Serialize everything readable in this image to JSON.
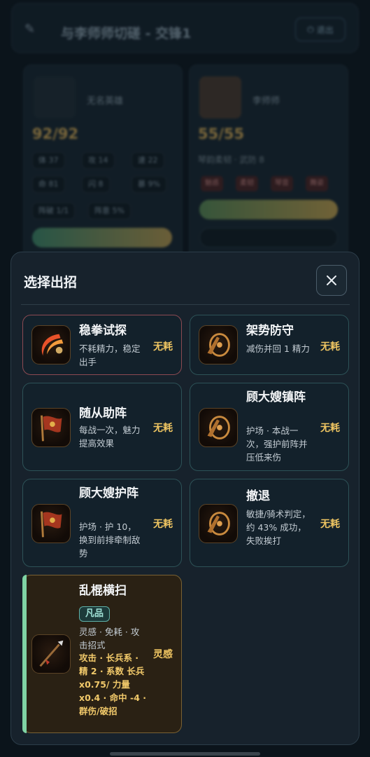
{
  "background": {
    "title": "与李师师切磋 - 交锋1",
    "title_button": "退出",
    "left_card": {
      "name": "无名英雄",
      "hp": "92/92",
      "stats": [
        "体 37",
        "攻 14",
        "速 22",
        "命 81",
        "闪 8",
        "暴 9%"
      ],
      "extra": [
        "阵破 1/1",
        "阵意 5%"
      ]
    },
    "right_card": {
      "name": "李师师",
      "hp": "55/55",
      "sub": "琴韵柔韧 · 武防 8",
      "tags": [
        "魅惑",
        "柔韧",
        "琴音",
        "舞姿"
      ]
    }
  },
  "modal": {
    "title": "选择出招",
    "close_icon": "close-icon",
    "skills": [
      {
        "name": "稳拳试探",
        "desc": "不耗精力，稳定出手",
        "cost": "无耗",
        "icon": "slash-icon",
        "selected": true
      },
      {
        "name": "架势防守",
        "desc": "减伤并回 1 精力",
        "cost": "无耗",
        "icon": "shield-icon"
      },
      {
        "name": "随从助阵",
        "desc": "每战一次，魅力提高效果",
        "cost": "无耗",
        "icon": "banner-icon"
      },
      {
        "name": "顾大嫂镇阵",
        "desc": "护场 · 本战一次，强护前阵并压低来伤",
        "cost": "无耗",
        "icon": "shield-icon"
      },
      {
        "name": "顾大嫂护阵",
        "desc": "护场 · 护 10，换到前排牵制敌势",
        "cost": "无耗",
        "icon": "banner-icon"
      },
      {
        "name": "撤退",
        "desc": "敏捷/骑术判定，约 43% 成功，失败挨打",
        "cost": "无耗",
        "icon": "shield-icon"
      },
      {
        "name": "乱棍横扫",
        "grade": "凡品",
        "desc": "灵感 · 免耗 · 攻击招式",
        "attrs": "攻击 · 长兵系 · 精 2 · 系数 长兵 x0.75/ 力量 x0.4 · 命中 -4 · 群伤/破招",
        "cost": "灵感",
        "icon": "spear-icon"
      }
    ]
  }
}
